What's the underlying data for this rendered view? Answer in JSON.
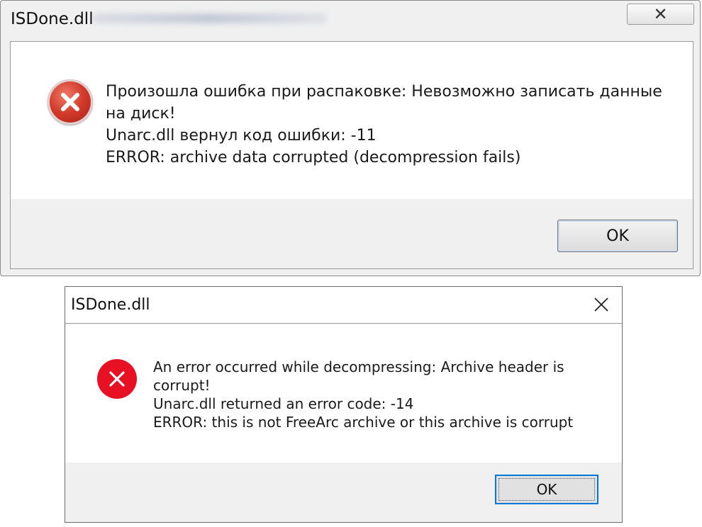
{
  "dialog_ru": {
    "title": "ISDone.dll",
    "message_lines": [
      "Произошла ошибка при распаковке: Невозможно записать данные",
      "на диск!",
      "Unarc.dll вернул код ошибки: -11",
      "ERROR: archive data corrupted (decompression fails)"
    ],
    "ok_label": "OK",
    "close_glyph": "✕"
  },
  "dialog_en": {
    "title": "ISDone.dll",
    "message_lines": [
      "An error occurred while decompressing: Archive header is",
      "corrupt!",
      "Unarc.dll returned an error code: -14",
      "ERROR: this is not FreeArc archive or this archive is corrupt"
    ],
    "ok_label": "OK"
  },
  "icons": {
    "error": "error-icon",
    "close": "close-icon"
  },
  "colors": {
    "win7_error_red": "#d23b2b",
    "win10_error_red": "#e81123",
    "win10_focus_blue": "#0078d7"
  }
}
